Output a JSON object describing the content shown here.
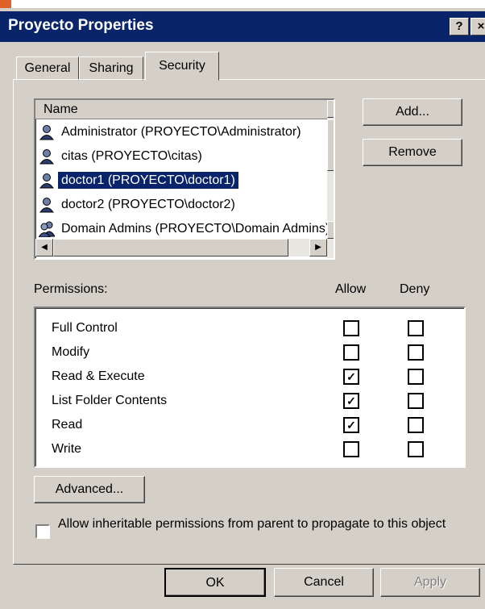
{
  "window": {
    "title": "Proyecto Properties",
    "help_glyph": "?",
    "close_glyph": "×"
  },
  "tabs": [
    {
      "label": "General"
    },
    {
      "label": "Sharing"
    },
    {
      "label": "Security",
      "active": true
    }
  ],
  "users": {
    "column_header": "Name",
    "items": [
      {
        "label": "Administrator (PROYECTO\\Administrator)",
        "icon": "user-icon"
      },
      {
        "label": "citas (PROYECTO\\citas)",
        "icon": "user-icon"
      },
      {
        "label": "doctor1 (PROYECTO\\doctor1)",
        "icon": "user-icon",
        "selected": true
      },
      {
        "label": "doctor2 (PROYECTO\\doctor2)",
        "icon": "user-icon"
      },
      {
        "label": "Domain Admins (PROYECTO\\Domain Admins)",
        "icon": "group-icon"
      }
    ]
  },
  "buttons": {
    "add": "Add...",
    "remove": "Remove",
    "advanced": "Advanced...",
    "ok": "OK",
    "cancel": "Cancel",
    "apply": "Apply"
  },
  "permissions": {
    "label": "Permissions:",
    "allow_label": "Allow",
    "deny_label": "Deny",
    "items": [
      {
        "label": "Full Control",
        "allow": false,
        "deny": false
      },
      {
        "label": "Modify",
        "allow": false,
        "deny": false
      },
      {
        "label": "Read & Execute",
        "allow": true,
        "deny": false
      },
      {
        "label": "List Folder Contents",
        "allow": true,
        "deny": false
      },
      {
        "label": "Read",
        "allow": true,
        "deny": false
      },
      {
        "label": "Write",
        "allow": false,
        "deny": false
      }
    ]
  },
  "inherit": {
    "label": "Allow inheritable permissions from parent to propagate to this object",
    "checked": false
  },
  "colors": {
    "titlebar": "#0a246a",
    "face": "#d4d0c8",
    "selection": "#0a246a"
  }
}
